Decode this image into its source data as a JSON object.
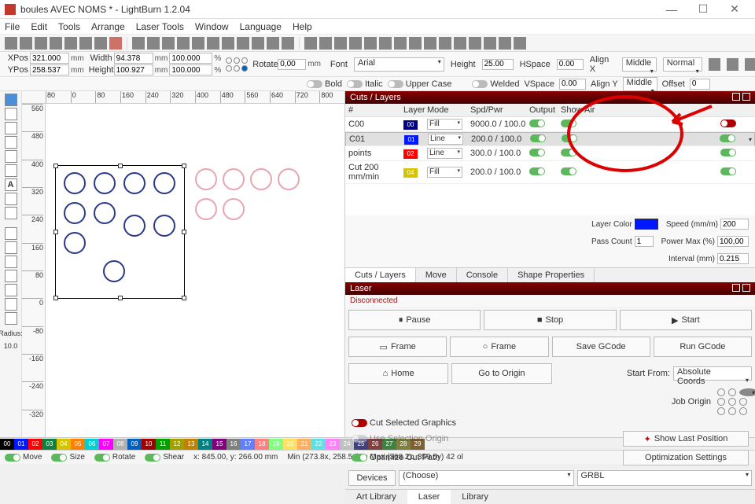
{
  "window": {
    "title": "boules AVEC NOMS * - LightBurn 1.2.04"
  },
  "menu": [
    "File",
    "Edit",
    "Tools",
    "Arrange",
    "Laser Tools",
    "Window",
    "Language",
    "Help"
  ],
  "pos": {
    "xpos_lbl": "XPos",
    "xpos": "321.000",
    "ypos_lbl": "YPos",
    "ypos": "258.537",
    "width_lbl": "Width",
    "width": "94.378",
    "height_lbl": "Height",
    "height": "100.927",
    "mm": "mm",
    "pw": "100.000",
    "ph": "100.000",
    "rotate_lbl": "Rotate",
    "rotate": "0,00"
  },
  "font": {
    "font_lbl": "Font",
    "font_val": "Arial",
    "height_lbl": "Height",
    "height_val": "25.00",
    "hspace_lbl": "HSpace",
    "hspace_val": "0.00",
    "alignx_lbl": "Align X",
    "alignx_val": "Middle",
    "normal": "Normal",
    "bold": "Bold",
    "italic": "Italic",
    "upper": "Upper Case",
    "welded": "Welded",
    "vspace_lbl": "VSpace",
    "vspace_val": "0.00",
    "aligny_lbl": "Align Y",
    "aligny_val": "Middle",
    "offset_lbl": "Offset",
    "offset_val": "0"
  },
  "radius": {
    "lbl": "Radius:",
    "val": "10.0"
  },
  "rulers": {
    "h": [
      "80",
      "0",
      "80",
      "160",
      "240",
      "320",
      "400",
      "480",
      "560",
      "640",
      "720",
      "800"
    ],
    "v": [
      "560",
      "480",
      "400",
      "320",
      "240",
      "160",
      "80",
      "0",
      "-80",
      "-160",
      "-240",
      "-320"
    ],
    "h2": [
      "80",
      "0",
      "80",
      "160",
      "240",
      "320",
      "400",
      "80",
      "0",
      "80",
      "160",
      "240",
      "320",
      "400",
      "480",
      "560",
      "640",
      "720",
      "800"
    ]
  },
  "cuts": {
    "title": "Cuts / Layers",
    "hdr": {
      "hash": "#",
      "layer": "Layer",
      "mode": "Mode",
      "spd": "Spd/Pwr",
      "out": "Output",
      "show": "Show",
      "air": "Air"
    },
    "rows": [
      {
        "name": "C00",
        "color": "#000080",
        "cnum": "00",
        "mode": "Fill",
        "spd": "9000.0 / 100.0"
      },
      {
        "name": "C01",
        "color": "#0018ff",
        "cnum": "01",
        "mode": "Line",
        "spd": "200.0 / 100.0"
      },
      {
        "name": "points",
        "color": "#ff0000",
        "cnum": "02",
        "mode": "Line",
        "spd": "300.0 / 100.0"
      },
      {
        "name": "Cut 200 mm/min",
        "color": "#d4c500",
        "cnum": "04",
        "mode": "Fill",
        "spd": "200.0 / 100.0"
      }
    ],
    "opts": {
      "layercolor_lbl": "Layer Color",
      "speed_lbl": "Speed (mm/m)",
      "speed_val": "200",
      "passcount_lbl": "Pass Count",
      "passcount_val": "1",
      "powermax_lbl": "Power Max (%)",
      "powermax_val": "100,00",
      "interval_lbl": "Interval (mm)",
      "interval_val": "0.215"
    }
  },
  "tabs_cuts": [
    "Cuts / Layers",
    "Move",
    "Console",
    "Shape Properties"
  ],
  "laser": {
    "title": "Laser",
    "disc": "Disconnected",
    "pause": "Pause",
    "stop": "Stop",
    "start": "Start",
    "frame1": "Frame",
    "frame2": "Frame",
    "savegcode": "Save GCode",
    "rungcode": "Run GCode",
    "home": "Home",
    "goto": "Go to Origin",
    "startfrom_lbl": "Start From:",
    "startfrom_val": "Absolute Coords",
    "joborigin_lbl": "Job Origin",
    "cutsel": "Cut Selected Graphics",
    "usesel": "Use Selection Origin",
    "showlast": "Show Last Position",
    "optpath": "Optimize Cut Path",
    "optset": "Optimization Settings",
    "devices": "Devices",
    "choose": "(Choose)",
    "grbl": "GRBL"
  },
  "bottom_tabs": [
    "Art Library",
    "Laser",
    "Library"
  ],
  "colors": [
    "00",
    "01",
    "02",
    "03",
    "04",
    "05",
    "06",
    "07",
    "08",
    "09",
    "10",
    "11",
    "12",
    "13",
    "14",
    "15",
    "16",
    "17",
    "18",
    "19",
    "20",
    "21",
    "22",
    "23",
    "24",
    "25",
    "26",
    "27",
    "28",
    "29"
  ],
  "colorhex": [
    "#000",
    "#0018ff",
    "#f00",
    "#108040",
    "#d4c500",
    "#ff8000",
    "#00cfcf",
    "#ff00ff",
    "#b0b0b0",
    "#0060c0",
    "#a00000",
    "#00a000",
    "#a0a000",
    "#c08000",
    "#008080",
    "#800080",
    "#808080",
    "#6080ff",
    "#ff8080",
    "#80ff80",
    "#ffe060",
    "#ffb060",
    "#60e0e0",
    "#ff80ff",
    "#c0c0c0",
    "#404080",
    "#804040",
    "#408040",
    "#808040",
    "#806030"
  ],
  "status": {
    "move": "Move",
    "size": "Size",
    "rotate": "Rotate",
    "shear": "Shear",
    "coords": "x: 845.00, y: 266.00 mm",
    "bounds": "Min (273.8x, 258.5y) to Max (368.2x, 359.5y)  42 ol"
  }
}
